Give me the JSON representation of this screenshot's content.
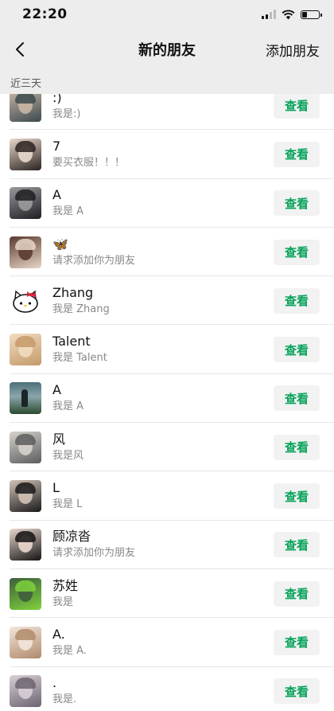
{
  "status_bar": {
    "time": "22:20"
  },
  "nav": {
    "title": "新的朋友",
    "action": "添加朋友"
  },
  "section": {
    "label": "近三天"
  },
  "view_label": "查看",
  "items": [
    {
      "name": ":)",
      "message": "我是:)",
      "avatar": "portrait-photo",
      "colors": [
        "#3c4a4f",
        "#c9b7a5"
      ]
    },
    {
      "name": "7",
      "message": "要买衣服！！！",
      "avatar": "portrait-photo",
      "colors": [
        "#2b2320",
        "#e9d8cc"
      ]
    },
    {
      "name": "A",
      "message": "我是 A",
      "avatar": "portrait-photo",
      "colors": [
        "#1e1e22",
        "#9a9a9e"
      ]
    },
    {
      "name": "🦋",
      "message": "请求添加你为朋友",
      "avatar": "portrait-photo",
      "colors": [
        "#e8d6c8",
        "#5a3b2e"
      ]
    },
    {
      "name": "Zhang",
      "message": "我是 Zhang",
      "avatar": "hello-kitty",
      "colors": [
        "#ffffff",
        "#d9213a"
      ]
    },
    {
      "name": "Talent",
      "message": "我是 Talent",
      "avatar": "portrait-photo",
      "colors": [
        "#c49a6a",
        "#f1dcc0"
      ]
    },
    {
      "name": "A",
      "message": "我是 A",
      "avatar": "landscape-photo",
      "colors": [
        "#4c6f79",
        "#2b4a2f"
      ]
    },
    {
      "name": "风",
      "message": "我是风",
      "avatar": "portrait-photo",
      "colors": [
        "#5d5d5f",
        "#d6d2cc"
      ]
    },
    {
      "name": "L",
      "message": "我是 L",
      "avatar": "portrait-photo",
      "colors": [
        "#1a1a1a",
        "#d2c3b7"
      ]
    },
    {
      "name": "顾凉沓",
      "message": "请求添加你为朋友",
      "avatar": "portrait-photo",
      "colors": [
        "#141414",
        "#ead7cd"
      ]
    },
    {
      "name": "苏姓",
      "message": "我是",
      "avatar": "portrait-photo",
      "colors": [
        "#7fd23c",
        "#3e5e3c"
      ]
    },
    {
      "name": "A.",
      "message": "我是 A.",
      "avatar": "portrait-photo",
      "colors": [
        "#b08a6b",
        "#f2e6dc"
      ]
    },
    {
      "name": ".",
      "message": "我是.",
      "avatar": "portrait-photo",
      "colors": [
        "#6c6470",
        "#d8cfd6"
      ]
    }
  ]
}
